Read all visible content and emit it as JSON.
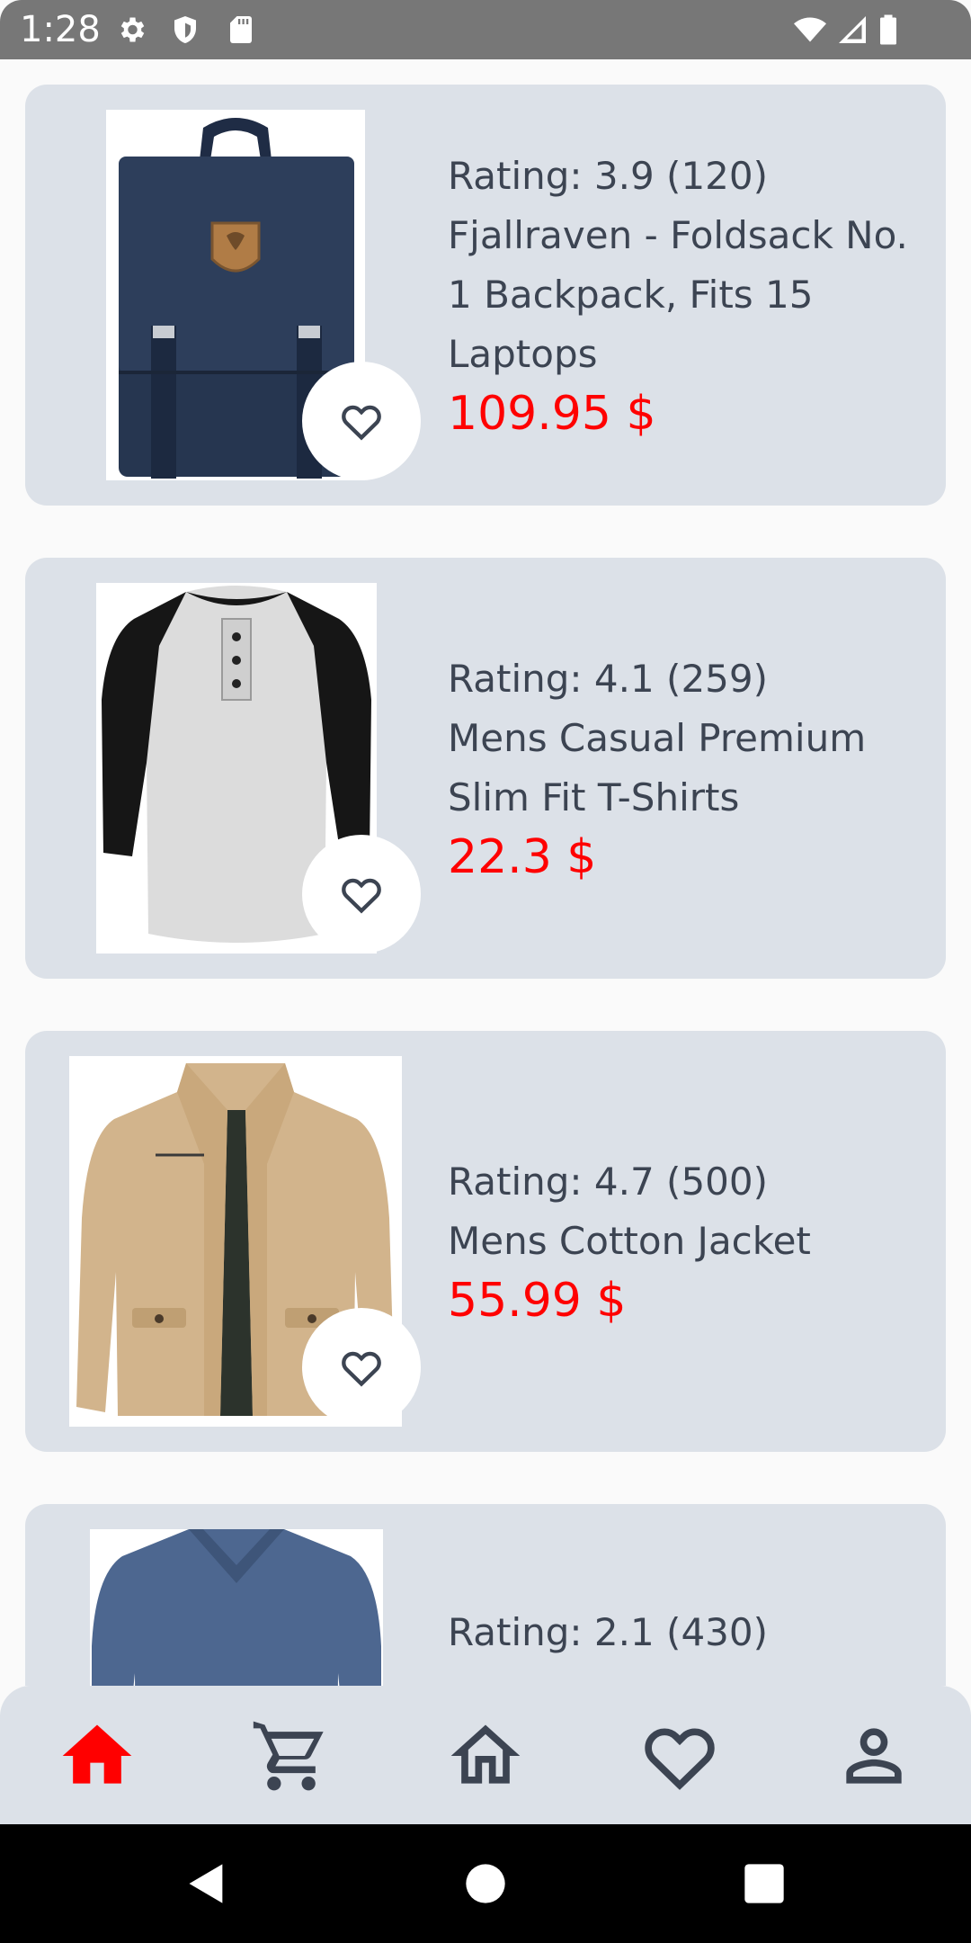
{
  "status_bar": {
    "time": "1:28",
    "left_icons": [
      "gear-icon",
      "shield-icon",
      "sd-card-icon"
    ],
    "right_icons": [
      "wifi-icon",
      "signal-icon",
      "battery-icon"
    ]
  },
  "products": [
    {
      "image": "backpack",
      "rating": "Rating: 3.9 (120)",
      "title_lines": [
        "Fjallraven - Foldsack No.",
        "1 Backpack, Fits 15",
        "Laptops"
      ],
      "price": "109.95 $"
    },
    {
      "image": "raglan-shirt",
      "rating": "Rating: 4.1 (259)",
      "title_lines": [
        "Mens Casual Premium",
        "Slim Fit T-Shirts"
      ],
      "price": "22.3 $"
    },
    {
      "image": "jacket",
      "rating": "Rating: 4.7 (500)",
      "title_lines": [
        "Mens Cotton Jacket"
      ],
      "price": "55.99 $"
    },
    {
      "image": "sweater",
      "rating": "Rating: 2.1 (430)"
    }
  ],
  "bottom_nav": {
    "items": [
      "home-icon",
      "cart-icon",
      "store-icon",
      "favorites-icon",
      "profile-icon"
    ],
    "selected": "home-icon",
    "active_color": "#ff0000",
    "inactive_color": "#3c4452"
  },
  "colors": {
    "card_background": "#dce1e8",
    "price": "#ff0000",
    "text": "#3c4452"
  }
}
